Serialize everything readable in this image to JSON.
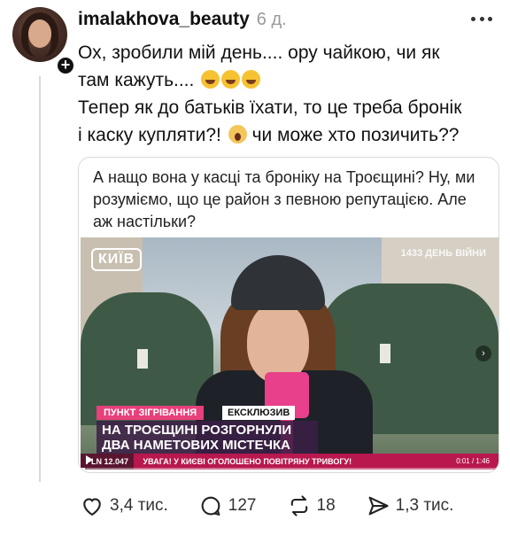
{
  "post": {
    "username": "imalakhova_beauty",
    "timestamp": "6 д.",
    "line1": "Ох, зробили мій день.... ору чайкою, чи як",
    "line2": "там кажуть....",
    "line3": "Тепер як до батьків їхати, то це треба бронік",
    "line4a": "і каску купляти?!",
    "line4b": "чи може хто позичить??"
  },
  "quote": {
    "text": "А нащо вона у касці та броніку на Троєщині? Ну, ми розуміємо, що це район з певною репутацією. Але аж настільки?"
  },
  "video": {
    "city_badge": "КИЇВ",
    "day_label": "1433 ДЕНЬ ВІЙНИ",
    "tag1": "ПУНКТ ЗІГРІВАННЯ",
    "tag2": "ЕКСКЛЮЗИВ",
    "headline": "НА ТРОЄЩИНІ РОЗГОРНУЛИ ДВА НАМЕТОВИХ МІСТЕЧКА",
    "ticker_index": "PLN 12.047",
    "ticker_text": "УВАГА! У КИЄВІ ОГОЛОШЕНО ПОВІТРЯНУ ТРИВОГУ!",
    "time": "0:01 / 1:46",
    "progress": 0.01
  },
  "actions": {
    "likes": "3,4 тис.",
    "replies": "127",
    "reposts": "18",
    "shares": "1,3 тис."
  },
  "icons": [
    "heart-icon",
    "comment-icon",
    "repost-icon",
    "share-icon",
    "more-icon",
    "plus-icon",
    "play-icon",
    "chevron-right-icon"
  ]
}
